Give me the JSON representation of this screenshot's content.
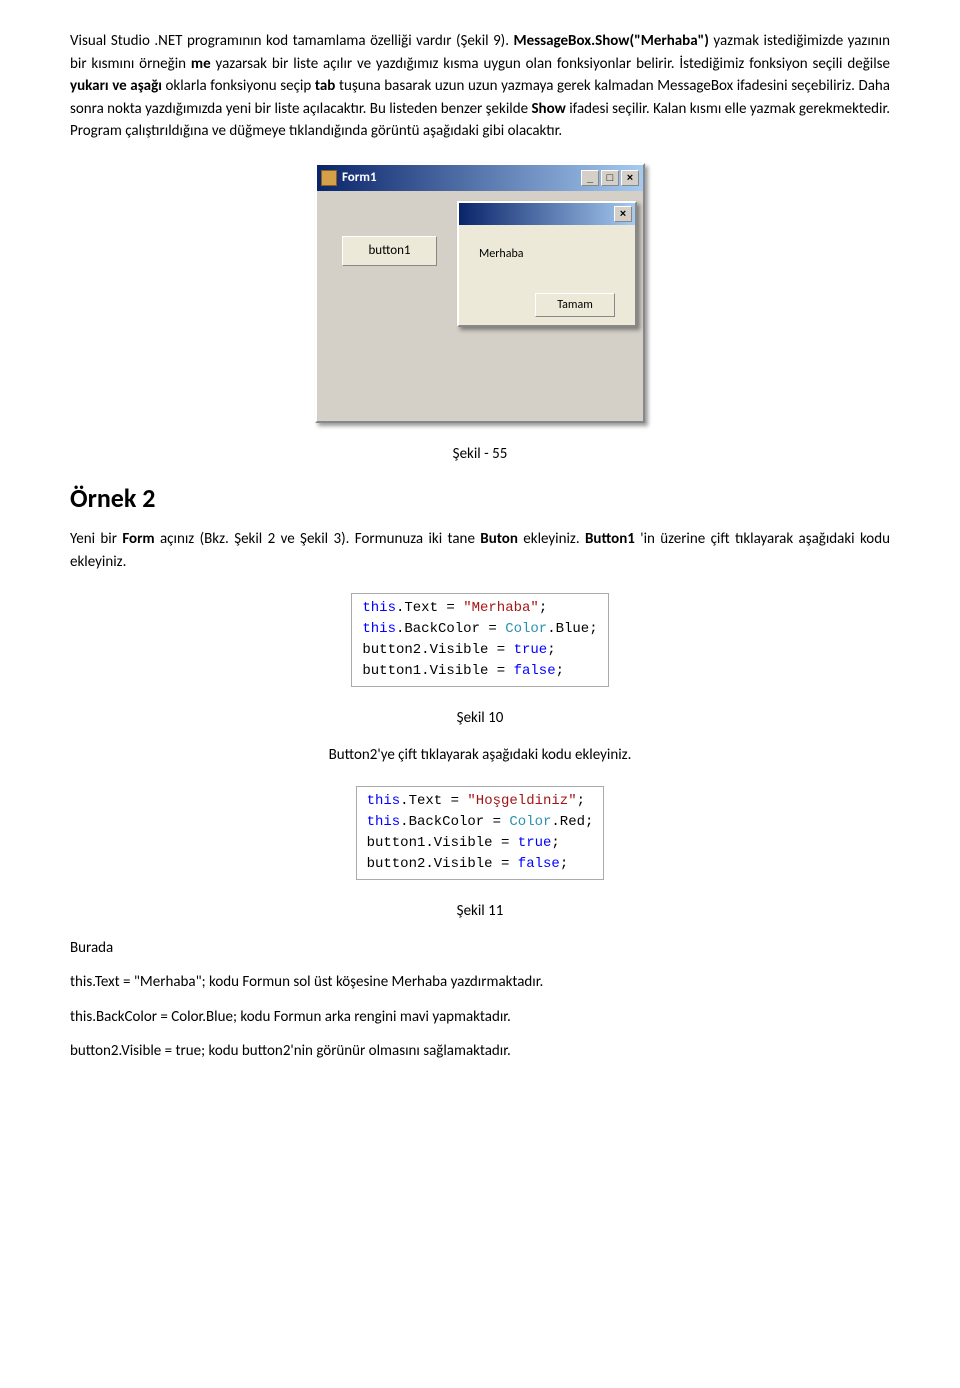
{
  "p1": {
    "t1": "Visual Studio .NET programının kod tamamlama özelliği vardır (Şekil 9). ",
    "b1": "MessageBox.Show(\"Merhaba\")",
    "t2": " yazmak istediğimizde yazının bir kısmını örneğin ",
    "b2": "me",
    "t3": " yazarsak bir liste açılır ve yazdığımız kısma uygun olan fonksiyonlar belirir. İstediğimiz fonksiyon seçili değilse ",
    "b3": "yukarı ve aşağı",
    "t4": " oklarla fonksiyonu seçip ",
    "b4": "tab",
    "t5": " tuşuna basarak uzun uzun yazmaya gerek kalmadan MessageBox ifadesini seçebiliriz. Daha sonra nokta yazdığımızda yeni bir liste açılacaktır. Bu listeden benzer şekilde ",
    "b5": "Show",
    "t6": " ifadesi seçilir. Kalan kısmı elle yazmak gerekmektedir. Program çalıştırıldığına ve düğmeye tıklandığında görüntü aşağıdaki gibi olacaktır."
  },
  "form1": {
    "title": "Form1",
    "min": "_",
    "max": "□",
    "close": "×",
    "button1": "button1",
    "dialogText": "Merhaba",
    "dialogButton": "Tamam"
  },
  "caption55": "Şekil - 55",
  "heading2": "Örnek 2",
  "p2": {
    "t1": "Yeni bir ",
    "b1": "Form",
    "t2": " açınız (Bkz. Şekil 2 ve Şekil 3). Formunuza iki tane ",
    "b2": "Buton",
    "t3": " ekleyiniz. ",
    "b3": "Button1",
    "t4": "'in üzerine çift tıklayarak aşağıdaki kodu ekleyiniz."
  },
  "code1": {
    "l1a": "this",
    "l1b": ".Text = ",
    "l1c": "\"Merhaba\"",
    "l1d": ";",
    "l2a": "this",
    "l2b": ".BackColor = ",
    "l2c": "Color",
    "l2d": ".Blue;",
    "l3a": "button2.Visible = ",
    "l3b": "true",
    "l3c": ";",
    "l4a": "button1.Visible = ",
    "l4b": "false",
    "l4c": ";"
  },
  "caption10": "Şekil 10",
  "p3": "Button2'ye çift tıklayarak aşağıdaki kodu ekleyiniz.",
  "code2": {
    "l1a": "this",
    "l1b": ".Text = ",
    "l1c": "\"Hoşgeldiniz\"",
    "l1d": ";",
    "l2a": "this",
    "l2b": ".BackColor = ",
    "l2c": "Color",
    "l2d": ".Red;",
    "l3a": "button1.Visible = ",
    "l3b": "true",
    "l3c": ";",
    "l4a": "button2.Visible = ",
    "l4b": "false",
    "l4c": ";"
  },
  "caption11": "Şekil 11",
  "p4": "Burada",
  "p5a": "this.Text = \"Merhaba\";",
  "p5b": " kodu Formun sol üst köşesine Merhaba yazdırmaktadır.",
  "p6a": "this.BackColor = Color.Blue;",
  "p6b": " kodu Formun arka rengini mavi yapmaktadır.",
  "p7a": "button2.Visible = true;",
  "p7b": " kodu button2'nin görünür olmasını sağlamaktadır."
}
